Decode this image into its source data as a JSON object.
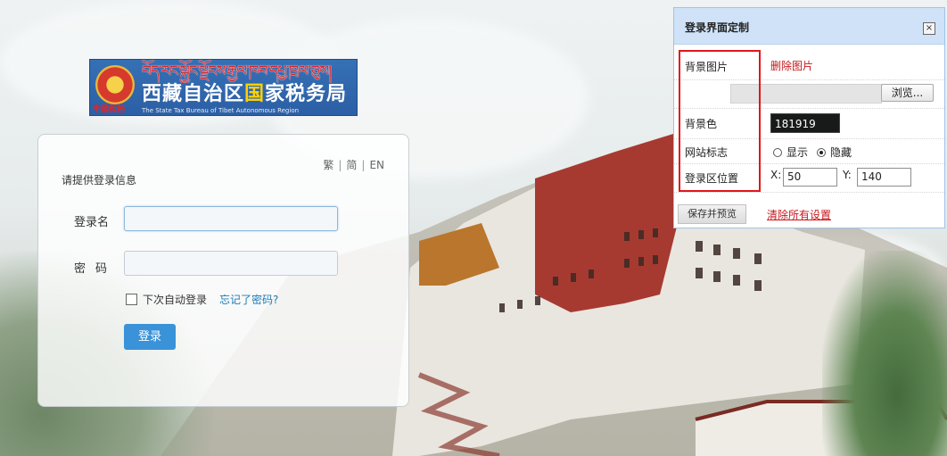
{
  "logo": {
    "tibetan_text": "བོད་རང་སྐྱོང་ལྗོངས་རྒྱལ་ཁབ་དཔྱ་ཁྲལ་ཅུས།",
    "cn_prefix": "西藏自治区",
    "cn_highlight": "国",
    "cn_suffix": "家税务局",
    "en_text": "The State Tax Bureau of Tibet Autonomous Region",
    "small_red_text": "中國稅務"
  },
  "login": {
    "lang_trad": "繁",
    "lang_simp": "简",
    "lang_en": "EN",
    "prompt": "请提供登录信息",
    "username_label": "登录名",
    "password_label": "密码",
    "username_value": "",
    "password_value": "",
    "remember_label": "下次自动登录",
    "forgot_label": "忘记了密码?",
    "submit_label": "登录"
  },
  "settings": {
    "title": "登录界面定制",
    "close_glyph": "×",
    "bg_image_label": "背景图片",
    "delete_image_label": "删除图片",
    "browse_label": "浏览...",
    "bg_color_label": "背景色",
    "bg_color_value": "181919",
    "site_logo_label": "网站标志",
    "show_label": "显示",
    "hide_label": "隐藏",
    "logo_selected": "hide",
    "position_label": "登录区位置",
    "x_label": "X:",
    "x_value": "50",
    "y_label": "Y:",
    "y_value": "140",
    "save_label": "保存并预览",
    "clear_label": "清除所有设置"
  },
  "colors": {
    "accent_blue": "#3a92d8",
    "link_blue": "#1e7bb8",
    "warn_red": "#c6171b",
    "dialog_header": "#cfe2f7"
  }
}
